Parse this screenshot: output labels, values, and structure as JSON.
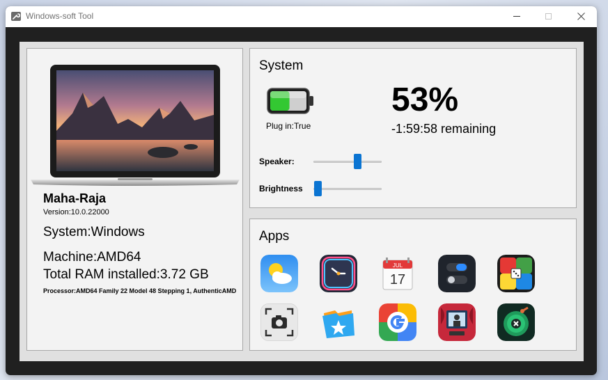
{
  "window": {
    "title": "Windows-soft Tool"
  },
  "device": {
    "name": "Maha-Raja",
    "version": "Version:10.0.22000",
    "system": "System:Windows",
    "machine": "Machine:AMD64",
    "ram": "Total RAM installed:3.72 GB",
    "processor": "Processor:AMD64 Family 22 Model 48 Stepping 1, AuthenticAMD"
  },
  "system_panel": {
    "title": "System",
    "plug_status": "Plug in:True",
    "battery_percent": "53%",
    "battery_level": 0.53,
    "remaining": "-1:59:58 remaining",
    "speaker_label": "Speaker:",
    "speaker_level": 0.64,
    "brightness_label": "Brightness",
    "brightness_level": 0.06
  },
  "apps_panel": {
    "title": "Apps",
    "apps": [
      {
        "icon": "weather-icon"
      },
      {
        "icon": "clock-icon"
      },
      {
        "icon": "calendar-icon",
        "month": "JUL",
        "day": "17"
      },
      {
        "icon": "toggle-settings-icon"
      },
      {
        "icon": "ludo-game-icon"
      },
      {
        "icon": "screenshot-icon"
      },
      {
        "icon": "files-icon"
      },
      {
        "icon": "google-icon"
      },
      {
        "icon": "photo-booth-icon"
      },
      {
        "icon": "bowling-game-icon"
      }
    ]
  },
  "colors": {
    "accent": "#0a74d2",
    "battery": "#33c832"
  }
}
